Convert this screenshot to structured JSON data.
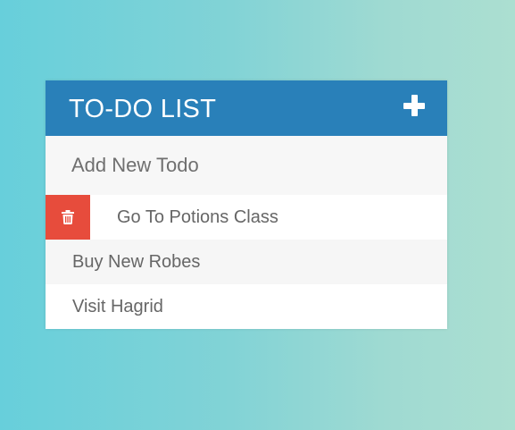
{
  "header": {
    "title": "TO-DO LIST",
    "add_icon": "plus-icon"
  },
  "new_todo": {
    "placeholder": "Add New Todo",
    "value": ""
  },
  "todos": [
    {
      "text": "Go To Potions Class",
      "delete_revealed": true,
      "delete_icon": "trash-icon"
    },
    {
      "text": "Buy New Robes",
      "delete_revealed": false
    },
    {
      "text": "Visit Hagrid",
      "delete_revealed": false
    }
  ],
  "colors": {
    "header_bg": "#2980b9",
    "delete_bg": "#e74c3c",
    "background_gradient": [
      "#67cfdb",
      "#acdfd1"
    ]
  }
}
